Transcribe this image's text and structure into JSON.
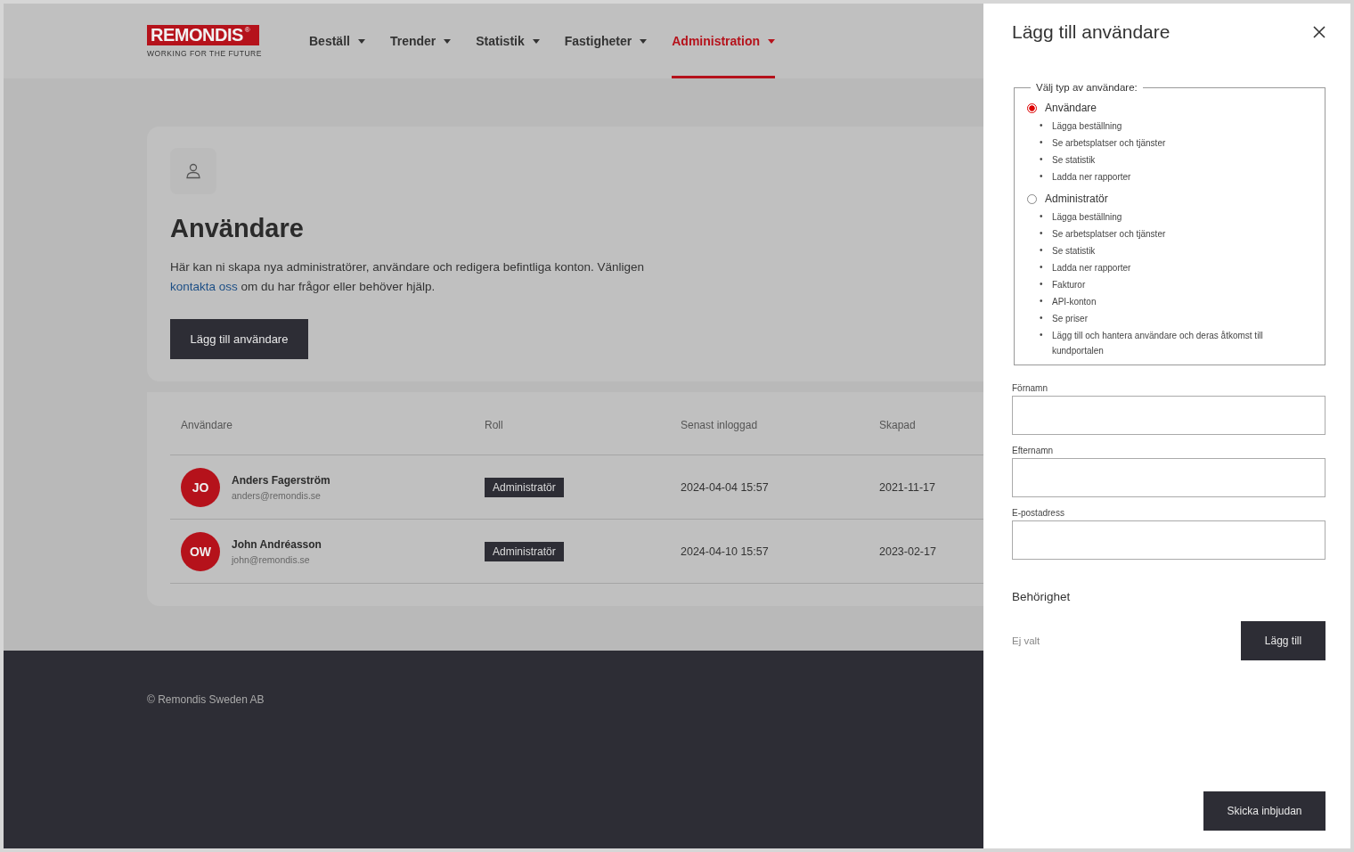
{
  "header": {
    "logo": {
      "name": "REMONDIS",
      "mark": "®",
      "tagline": "WORKING FOR THE FUTURE"
    },
    "nav": [
      {
        "label": "Beställ",
        "selected": false
      },
      {
        "label": "Trender",
        "selected": false
      },
      {
        "label": "Statistik",
        "selected": false
      },
      {
        "label": "Fastigheter",
        "selected": false
      },
      {
        "label": "Administration",
        "selected": true
      }
    ]
  },
  "intro": {
    "title": "Användare",
    "text_before": "Här kan ni skapa nya administratörer, användare och redigera befintliga konton. Vänligen ",
    "link": "kontakta oss",
    "text_after": " om du har frågor eller behöver hjälp.",
    "button": "Lägg till användare"
  },
  "table": {
    "columns": [
      "Användare",
      "Roll",
      "Senast inloggad",
      "Skapad"
    ],
    "rows": [
      {
        "initials": "JO",
        "name": "Anders Fagerström",
        "email": "anders@remondis.se",
        "role": "Administratör",
        "last_login": "2024-04-04 15:57",
        "created": "2021-11-17"
      },
      {
        "initials": "OW",
        "name": "John Andréasson",
        "email": "john@remondis.se",
        "role": "Administratör",
        "last_login": "2024-04-10 15:57",
        "created": "2023-02-17"
      }
    ]
  },
  "footer": {
    "copyright": "© Remondis Sweden AB"
  },
  "drawer": {
    "title": "Lägg till användare",
    "legend": "Välj typ av användare:",
    "bullet": "•",
    "options": [
      {
        "label": "Användare",
        "selected": true,
        "permissions": [
          "Lägga beställning",
          "Se arbetsplatser och tjänster",
          "Se statistik",
          "Ladda ner rapporter"
        ]
      },
      {
        "label": "Administratör",
        "selected": false,
        "permissions": [
          "Lägga beställning",
          "Se arbetsplatser och tjänster",
          "Se statistik",
          "Ladda ner rapporter",
          "Fakturor",
          "API-konton",
          "Se priser",
          "Lägg till och hantera användare och deras åtkomst till kundportalen"
        ]
      }
    ],
    "fields": [
      {
        "label": "Förnamn"
      },
      {
        "label": "Efternamn"
      },
      {
        "label": "E-postadress"
      }
    ],
    "section": "Behörighet",
    "permission_value": "Ej valt",
    "add_button": "Lägg till",
    "submit_button": "Skicka inbjudan"
  }
}
